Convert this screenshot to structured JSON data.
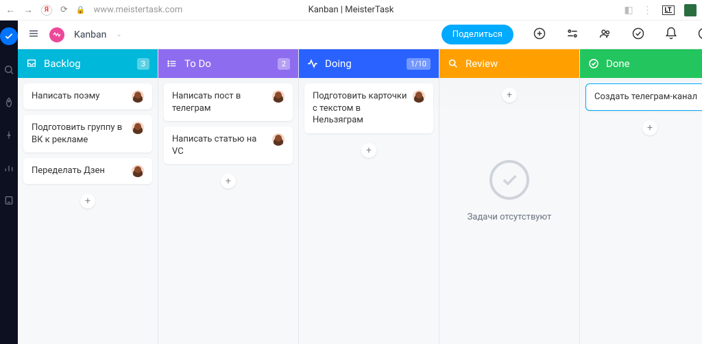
{
  "browser": {
    "url": "www.meistertask.com",
    "title": "Kanban | MeisterTask",
    "lt_ext": "LT"
  },
  "project": {
    "name": "Kanban"
  },
  "topbar": {
    "share": "Поделиться"
  },
  "columns": [
    {
      "title": "Backlog",
      "count": "3",
      "cards": [
        "Написать поэму",
        "Подготовить группу в ВК к рекламе",
        "Переделать Дзен"
      ]
    },
    {
      "title": "To Do",
      "count": "2",
      "cards": [
        "Написать пост в телеграм",
        "Написать статью на VC"
      ]
    },
    {
      "title": "Doing",
      "count": "1/10",
      "cards": [
        "Подготовить карточки с текстом в Нельзяграм"
      ]
    },
    {
      "title": "Review",
      "empty": "Задачи отсутствуют"
    },
    {
      "title": "Done",
      "cards": [
        "Создать телеграм-канал"
      ]
    }
  ]
}
